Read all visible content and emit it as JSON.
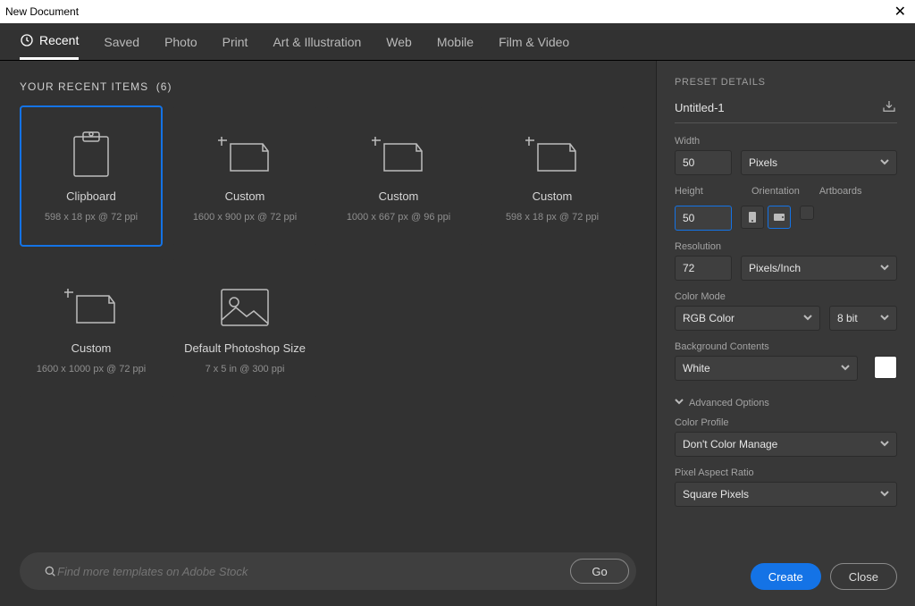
{
  "titlebar": {
    "title": "New Document"
  },
  "tabs": [
    "Recent",
    "Saved",
    "Photo",
    "Print",
    "Art & Illustration",
    "Web",
    "Mobile",
    "Film & Video"
  ],
  "section": {
    "label": "YOUR RECENT ITEMS",
    "count": "(6)"
  },
  "cards": [
    {
      "title": "Clipboard",
      "sub": "598 x 18 px @ 72 ppi",
      "icon": "clipboard"
    },
    {
      "title": "Custom",
      "sub": "1600 x 900 px @ 72 ppi",
      "icon": "doc"
    },
    {
      "title": "Custom",
      "sub": "1000 x 667 px @ 96 ppi",
      "icon": "doc"
    },
    {
      "title": "Custom",
      "sub": "598 x 18 px @ 72 ppi",
      "icon": "doc"
    },
    {
      "title": "Custom",
      "sub": "1600 x 1000 px @ 72 ppi",
      "icon": "doc"
    },
    {
      "title": "Default Photoshop Size",
      "sub": "7 x 5 in @ 300 ppi",
      "icon": "photo"
    }
  ],
  "search": {
    "placeholder": "Find more templates on Adobe Stock",
    "go": "Go"
  },
  "details": {
    "header": "PRESET DETAILS",
    "name": "Untitled-1",
    "width_label": "Width",
    "width": "50",
    "width_unit": "Pixels",
    "height_label": "Height",
    "height": "50",
    "orientation_label": "Orientation",
    "artboards_label": "Artboards",
    "resolution_label": "Resolution",
    "resolution": "72",
    "resolution_unit": "Pixels/Inch",
    "colormode_label": "Color Mode",
    "colormode": "RGB Color",
    "bitdepth": "8 bit",
    "bg_label": "Background Contents",
    "bg": "White",
    "advanced_label": "Advanced Options",
    "profile_label": "Color Profile",
    "profile": "Don't Color Manage",
    "aspect_label": "Pixel Aspect Ratio",
    "aspect": "Square Pixels"
  },
  "footer": {
    "create": "Create",
    "close": "Close"
  }
}
